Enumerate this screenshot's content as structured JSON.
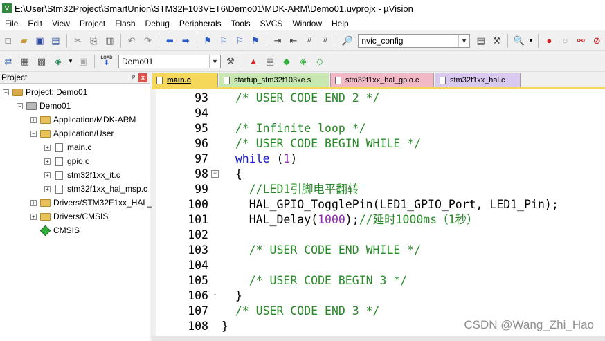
{
  "window": {
    "title": "E:\\User\\Stm32Project\\SmartUnion\\STM32F103VET6\\Demo01\\MDK-ARM\\Demo01.uvprojx - µVision"
  },
  "menu": [
    "File",
    "Edit",
    "View",
    "Project",
    "Flash",
    "Debug",
    "Peripherals",
    "Tools",
    "SVCS",
    "Window",
    "Help"
  ],
  "toolbar": {
    "find_combo": "nvic_config",
    "target_combo": "Demo01",
    "load_label": "LOAD"
  },
  "project": {
    "title": "Project",
    "pin": "ᵖ",
    "close": "x",
    "items": [
      {
        "label": "Project: Demo01",
        "level": 0,
        "toggle": "−",
        "icon": "project-icon"
      },
      {
        "label": "Demo01",
        "level": 1,
        "toggle": "−",
        "icon": "target-icon"
      },
      {
        "label": "Application/MDK-ARM",
        "level": 2,
        "toggle": "+",
        "icon": "folder-icon"
      },
      {
        "label": "Application/User",
        "level": 2,
        "toggle": "−",
        "icon": "folder-icon"
      },
      {
        "label": "main.c",
        "level": 3,
        "toggle": "+",
        "icon": "file-icon"
      },
      {
        "label": "gpio.c",
        "level": 3,
        "toggle": "+",
        "icon": "file-icon"
      },
      {
        "label": "stm32f1xx_it.c",
        "level": 3,
        "toggle": "+",
        "icon": "file-icon"
      },
      {
        "label": "stm32f1xx_hal_msp.c",
        "level": 3,
        "toggle": "+",
        "icon": "file-icon"
      },
      {
        "label": "Drivers/STM32F1xx_HAL_",
        "level": 2,
        "toggle": "+",
        "icon": "folder-icon"
      },
      {
        "label": "Drivers/CMSIS",
        "level": 2,
        "toggle": "+",
        "icon": "folder-icon"
      },
      {
        "label": "CMSIS",
        "level": 2,
        "toggle": "",
        "icon": "diamond-icon"
      }
    ]
  },
  "tabs": [
    {
      "label": "main.c",
      "active": true,
      "color": "#f5d75a"
    },
    {
      "label": "startup_stm32f103xe.s",
      "active": false,
      "color": "#c9e7b0"
    },
    {
      "label": "stm32f1xx_hal_gpio.c",
      "active": false,
      "color": "#f3b8c6"
    },
    {
      "label": "stm32f1xx_hal.c",
      "active": false,
      "color": "#d9c9f0"
    }
  ],
  "code_lines": [
    {
      "num": "93",
      "fold": "",
      "segments": [
        [
          "comment",
          "  /* USER CODE END 2 */"
        ]
      ]
    },
    {
      "num": "94",
      "fold": "",
      "segments": []
    },
    {
      "num": "95",
      "fold": "",
      "segments": [
        [
          "comment",
          "  /* Infinite loop */"
        ]
      ]
    },
    {
      "num": "96",
      "fold": "",
      "segments": [
        [
          "comment",
          "  /* USER CODE BEGIN WHILE */"
        ]
      ]
    },
    {
      "num": "97",
      "fold": "",
      "segments": [
        [
          "kw",
          "  while"
        ],
        [
          "plain",
          " ("
        ],
        [
          "num",
          "1"
        ],
        [
          "plain",
          ")"
        ]
      ]
    },
    {
      "num": "98",
      "fold": "−",
      "segments": [
        [
          "plain",
          "  {"
        ]
      ]
    },
    {
      "num": "99",
      "fold": "",
      "segments": [
        [
          "comment",
          "    //LED1引脚电平翻转"
        ]
      ]
    },
    {
      "num": "100",
      "fold": "",
      "segments": [
        [
          "plain",
          "    HAL_GPIO_TogglePin(LED1_GPIO_Port, LED1_Pin);"
        ]
      ]
    },
    {
      "num": "101",
      "fold": "",
      "segments": [
        [
          "plain",
          "    HAL_Delay("
        ],
        [
          "num",
          "1000"
        ],
        [
          "plain",
          ");"
        ],
        [
          "comment",
          "//延时1000ms（1秒）"
        ]
      ]
    },
    {
      "num": "102",
      "fold": "",
      "segments": []
    },
    {
      "num": "103",
      "fold": "",
      "segments": [
        [
          "comment",
          "    /* USER CODE END WHILE */"
        ]
      ]
    },
    {
      "num": "104",
      "fold": "",
      "segments": []
    },
    {
      "num": "105",
      "fold": "",
      "segments": [
        [
          "comment",
          "    /* USER CODE BEGIN 3 */"
        ]
      ]
    },
    {
      "num": "106",
      "fold": "-",
      "segments": [
        [
          "plain",
          "  }"
        ]
      ]
    },
    {
      "num": "107",
      "fold": "",
      "segments": [
        [
          "comment",
          "  /* USER CODE END 3 */"
        ]
      ]
    },
    {
      "num": "108",
      "fold": "",
      "segments": [
        [
          "plain",
          "}"
        ]
      ]
    }
  ],
  "watermark": "CSDN @Wang_Zhi_Hao",
  "icons": {
    "new": "☐",
    "open": "📂",
    "save": "💾",
    "save_all": "▣",
    "cut": "✂",
    "copy": "⎘",
    "paste": "📋",
    "undo": "↶",
    "redo": "↷",
    "back": "←",
    "forward": "→",
    "bookmark": "⚑",
    "indent": "⇥",
    "outdent": "⇤",
    "comment": "//",
    "find": "🔍",
    "build": "▦",
    "rebuild": "▤",
    "batch": "☰",
    "stop": "●",
    "options": "⚙"
  },
  "colors": {
    "comment": "#2a8a2a",
    "keyword": "#1a1ad0",
    "number": "#8a2aa8"
  }
}
